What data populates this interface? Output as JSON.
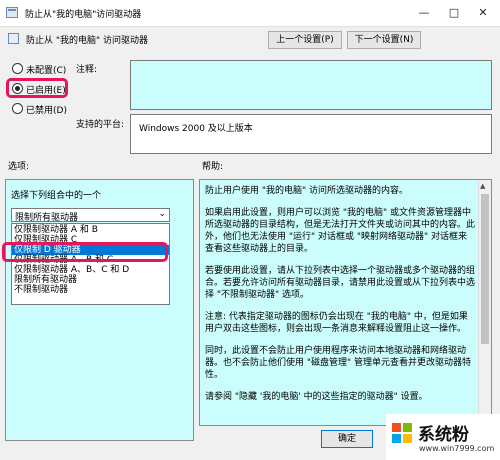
{
  "window": {
    "title": "防止从\"我的电脑\"访问驱动器",
    "minimize": "—",
    "maximize": "□",
    "close": "✕"
  },
  "header": {
    "title": "防止从 \"我的电脑\" 访问驱动器",
    "prev_button": "上一个设置(P)",
    "next_button": "下一个设置(N)"
  },
  "state": {
    "options": [
      {
        "label": "未配置(C)",
        "selected": false
      },
      {
        "label": "已启用(E)",
        "selected": true
      },
      {
        "label": "已禁用(D)",
        "selected": false
      }
    ]
  },
  "comment": {
    "label": "注释:",
    "value": ""
  },
  "platform": {
    "label": "支持的平台:",
    "value": "Windows 2000 及以上版本"
  },
  "options_panel": {
    "label": "选项:",
    "prompt": "选择下列组合中的一个",
    "selected": "限制所有驱动器",
    "dropdown_items": [
      "仅限制驱动器 A 和 B",
      "仅限制驱动器 C",
      "仅限制 D 驱动器",
      "仅限制驱动器 A、B 和 C",
      "仅限制驱动器 A、B、C 和 D",
      "限制所有驱动器",
      "不限制驱动器"
    ],
    "highlighted_index": 2
  },
  "help_panel": {
    "label": "帮助:",
    "paragraphs": [
      "防止用户使用 \"我的电脑\" 访问所选驱动器的内容。",
      "如果启用此设置，则用户可以浏览 \"我的电脑\" 或文件资源管理器中所选驱动器的目录结构，但是无法打开文件夹或访问其中的内容。此外，他们也无法使用 \"运行\" 对话框或 \"映射网络驱动器\" 对话框来查看这些驱动器上的目录。",
      "若要使用此设置，请从下拉列表中选择一个驱动器或多个驱动器的组合。若要允许访问所有驱动器目录，请禁用此设置或从下拉列表中选择 \"不限制驱动器\" 选项。",
      "注意: 代表指定驱动器的图标仍会出现在 \"我的电脑\" 中，但是如果用户双击这些图标，则会出现一条消息来解释设置阻止这一操作。",
      "同时，此设置不会防止用户使用程序来访问本地驱动器和网络驱动器。也不会防止他们使用 \"磁盘管理\" 管理单元查看并更改驱动器特性。",
      "请参阅 \"隐藏 '我的电脑' 中的这些指定的驱动器\" 设置。"
    ]
  },
  "footer": {
    "ok_button": "确定"
  },
  "watermark": {
    "brand": "系统粉",
    "url": "www.win7999.com"
  }
}
